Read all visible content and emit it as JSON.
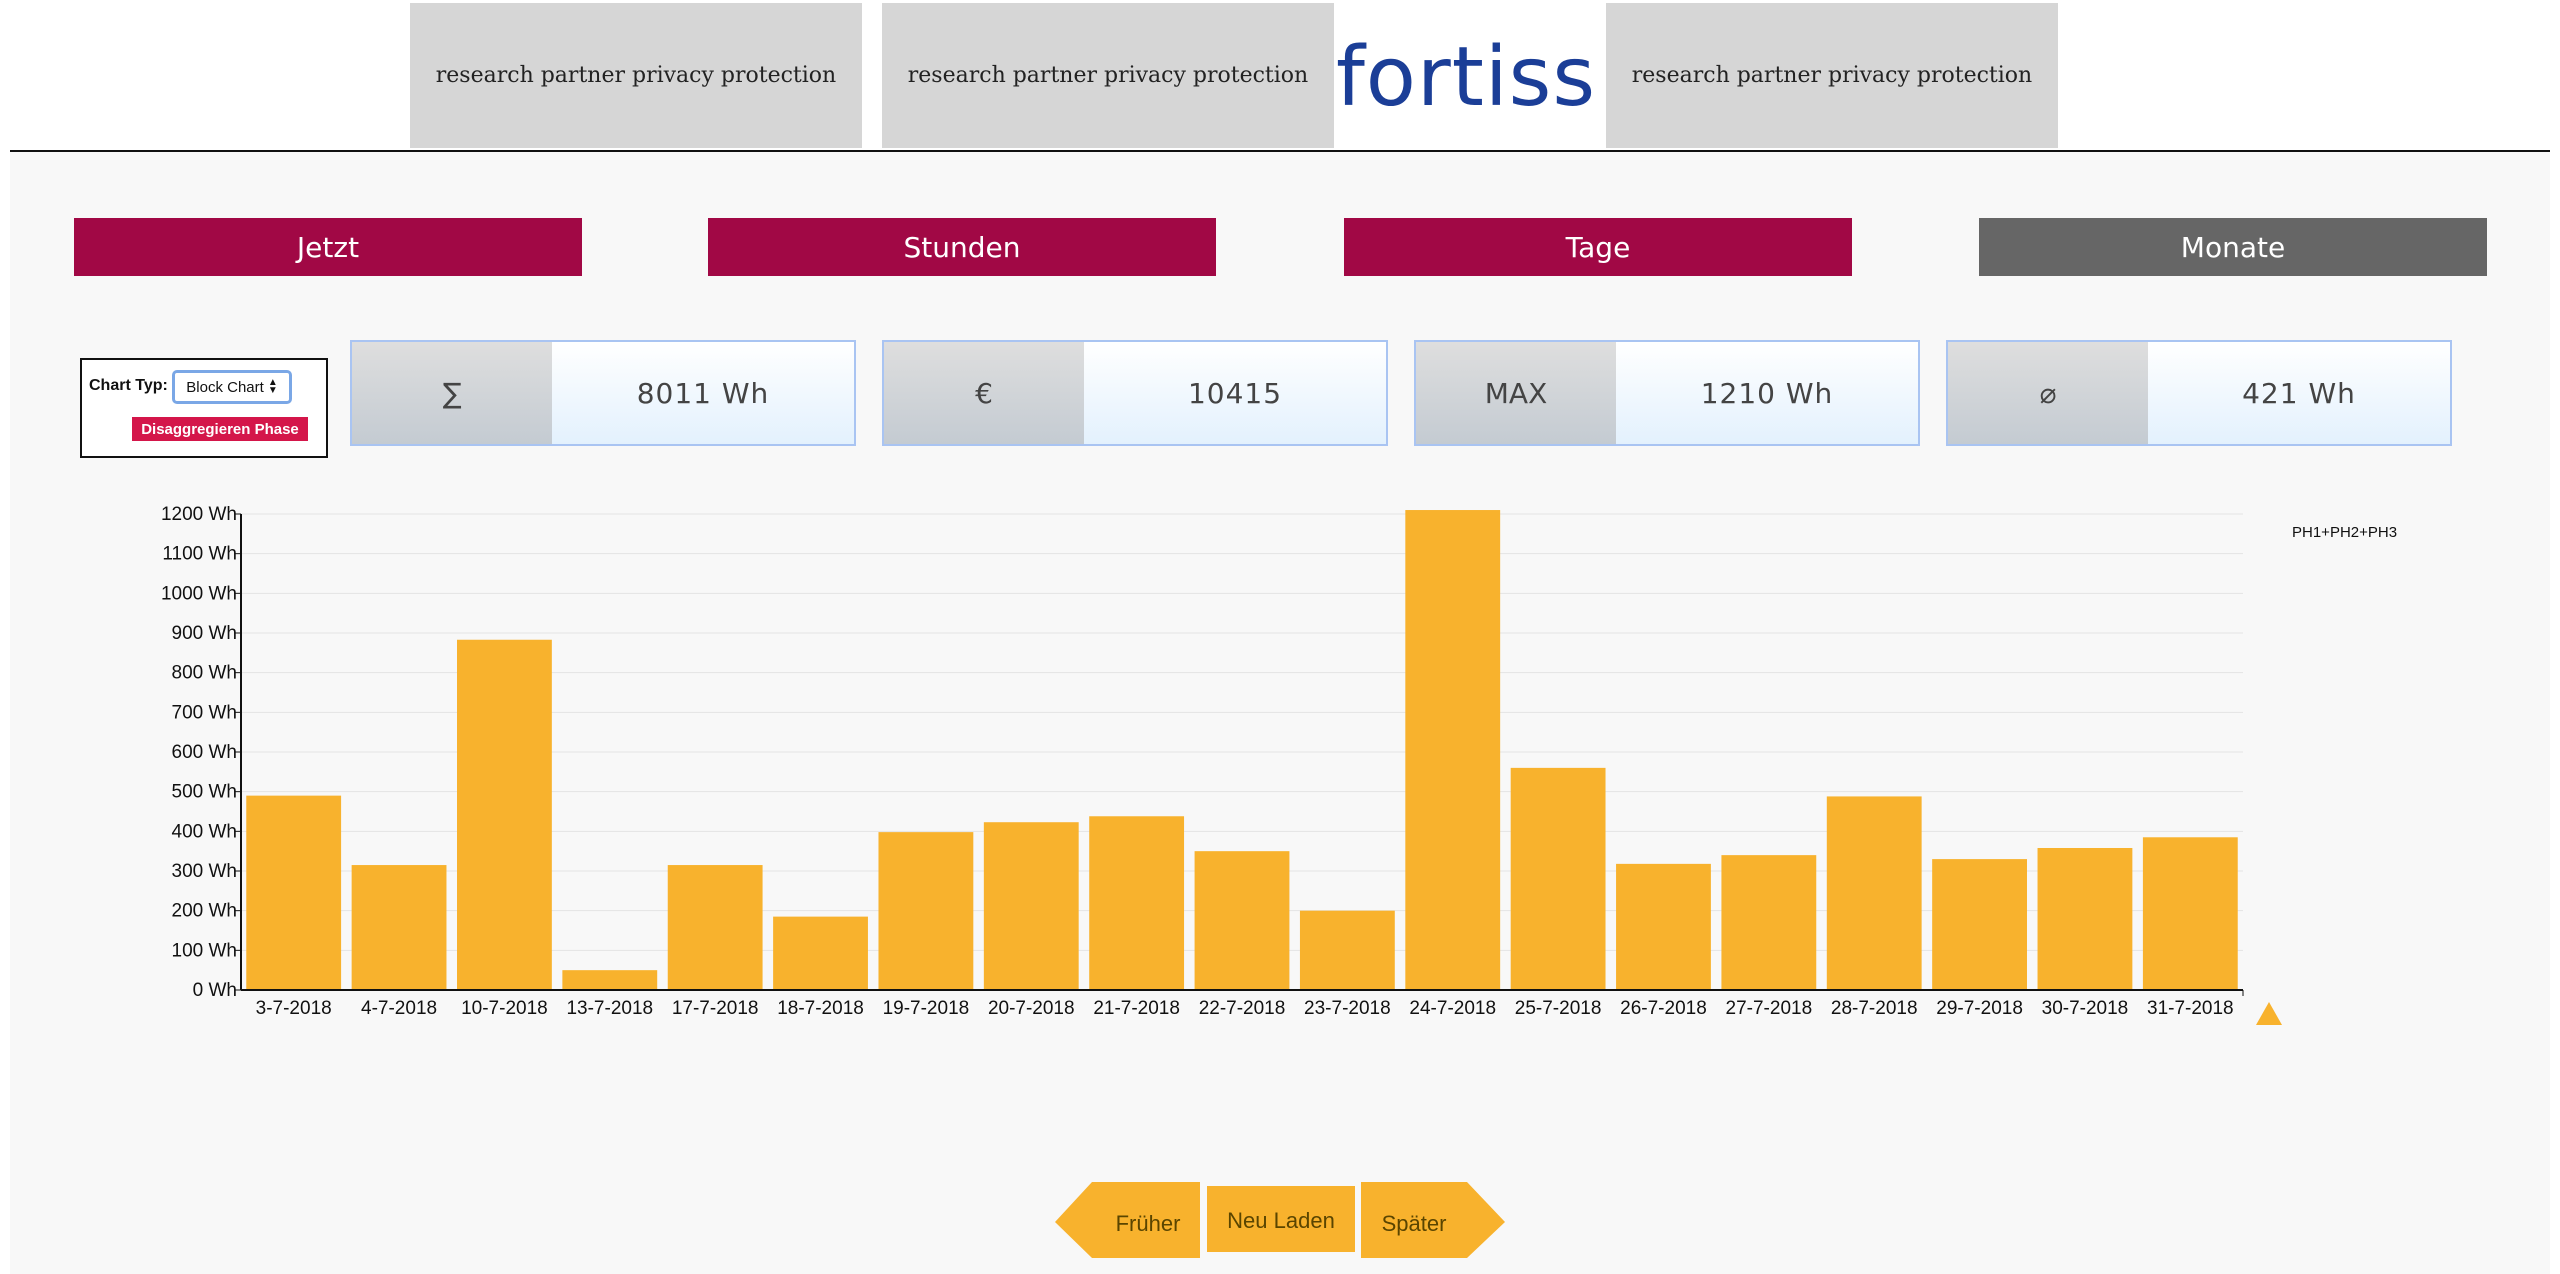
{
  "header": {
    "partners": [
      {
        "label": "research partner privacy protection"
      },
      {
        "label": "research partner privacy protection"
      },
      {
        "label": "research partner privacy protection"
      }
    ],
    "logo_text": "fortiss"
  },
  "time_tabs": [
    {
      "label": "Jetzt",
      "active": false
    },
    {
      "label": "Stunden",
      "active": false
    },
    {
      "label": "Tage",
      "active": false
    },
    {
      "label": "Monate",
      "active": true
    }
  ],
  "controls": {
    "chart_typ_label": "Chart Typ:",
    "chart_typ_value": "Block Chart",
    "disaggregate_label": "Disaggregieren Phase"
  },
  "stats": [
    {
      "symbol": "∑",
      "value": "8011 Wh"
    },
    {
      "symbol": "€",
      "value": "10415"
    },
    {
      "symbol": "MAX",
      "value": "1210 Wh"
    },
    {
      "symbol": "⌀",
      "value": "421 Wh"
    }
  ],
  "chart_data": {
    "type": "bar",
    "categories": [
      "3-7-2018",
      "4-7-2018",
      "10-7-2018",
      "13-7-2018",
      "17-7-2018",
      "18-7-2018",
      "19-7-2018",
      "20-7-2018",
      "21-7-2018",
      "22-7-2018",
      "23-7-2018",
      "24-7-2018",
      "25-7-2018",
      "26-7-2018",
      "27-7-2018",
      "28-7-2018",
      "29-7-2018",
      "30-7-2018",
      "31-7-2018"
    ],
    "series": [
      {
        "name": "PH1+PH2+PH3",
        "values": [
          490,
          315,
          883,
          50,
          315,
          185,
          398,
          423,
          438,
          350,
          200,
          1210,
          560,
          318,
          340,
          488,
          330,
          358,
          385
        ]
      }
    ],
    "ylim": [
      0,
      1200
    ],
    "yticks": [
      0,
      100,
      200,
      300,
      400,
      500,
      600,
      700,
      800,
      900,
      1000,
      1100,
      1200
    ],
    "ytick_suffix": " Wh",
    "grid": true,
    "legend_position": "top-right",
    "bar_color": "#f8b22d"
  },
  "navigation": {
    "earlier_label": "Früher",
    "reload_label": "Neu Laden",
    "later_label": "Später",
    "color": "#f8b22d"
  },
  "colors": {
    "tab_active": "#666666",
    "tab_inactive": "#a10845",
    "logo": "#1b3e97"
  }
}
